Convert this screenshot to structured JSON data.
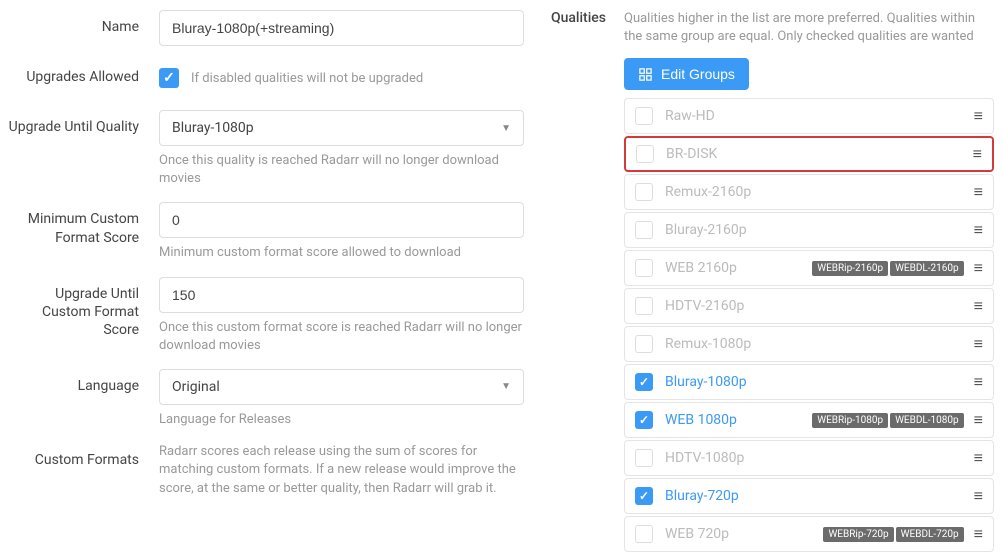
{
  "form": {
    "name_label": "Name",
    "name_value": "Bluray-1080p(+streaming)",
    "upgrades_label": "Upgrades Allowed",
    "upgrades_checked": true,
    "upgrades_help": "If disabled qualities will not be upgraded",
    "upgrade_until_label": "Upgrade Until Quality",
    "upgrade_until_value": "Bluray-1080p",
    "upgrade_until_help": "Once this quality is reached Radarr will no longer download movies",
    "min_score_label": "Minimum Custom Format Score",
    "min_score_value": "0",
    "min_score_help": "Minimum custom format score allowed to download",
    "upgrade_score_label": "Upgrade Until Custom Format Score",
    "upgrade_score_value": "150",
    "upgrade_score_help": "Once this custom format score is reached Radarr will no longer download movies",
    "language_label": "Language",
    "language_value": "Original",
    "language_help": "Language for Releases",
    "custom_formats_label": "Custom Formats",
    "custom_formats_help": "Radarr scores each release using the sum of scores for matching custom formats. If a new release would improve the score, at the same or better quality, then Radarr will grab it."
  },
  "qualities": {
    "label": "Qualities",
    "hint": "Qualities higher in the list are more preferred. Qualities within the same group are equal. Only checked qualities are wanted",
    "edit_groups_label": "Edit Groups",
    "items": [
      {
        "label": "Raw-HD",
        "checked": false,
        "tags": [],
        "highlighted": false
      },
      {
        "label": "BR-DISK",
        "checked": false,
        "tags": [],
        "highlighted": true
      },
      {
        "label": "Remux-2160p",
        "checked": false,
        "tags": [],
        "highlighted": false
      },
      {
        "label": "Bluray-2160p",
        "checked": false,
        "tags": [],
        "highlighted": false
      },
      {
        "label": "WEB 2160p",
        "checked": false,
        "tags": [
          "WEBRip-2160p",
          "WEBDL-2160p"
        ],
        "highlighted": false
      },
      {
        "label": "HDTV-2160p",
        "checked": false,
        "tags": [],
        "highlighted": false
      },
      {
        "label": "Remux-1080p",
        "checked": false,
        "tags": [],
        "highlighted": false
      },
      {
        "label": "Bluray-1080p",
        "checked": true,
        "tags": [],
        "highlighted": false
      },
      {
        "label": "WEB 1080p",
        "checked": true,
        "tags": [
          "WEBRip-1080p",
          "WEBDL-1080p"
        ],
        "highlighted": false
      },
      {
        "label": "HDTV-1080p",
        "checked": false,
        "tags": [],
        "highlighted": false
      },
      {
        "label": "Bluray-720p",
        "checked": true,
        "tags": [],
        "highlighted": false
      },
      {
        "label": "WEB 720p",
        "checked": false,
        "tags": [
          "WEBRip-720p",
          "WEBDL-720p"
        ],
        "highlighted": false
      }
    ]
  }
}
